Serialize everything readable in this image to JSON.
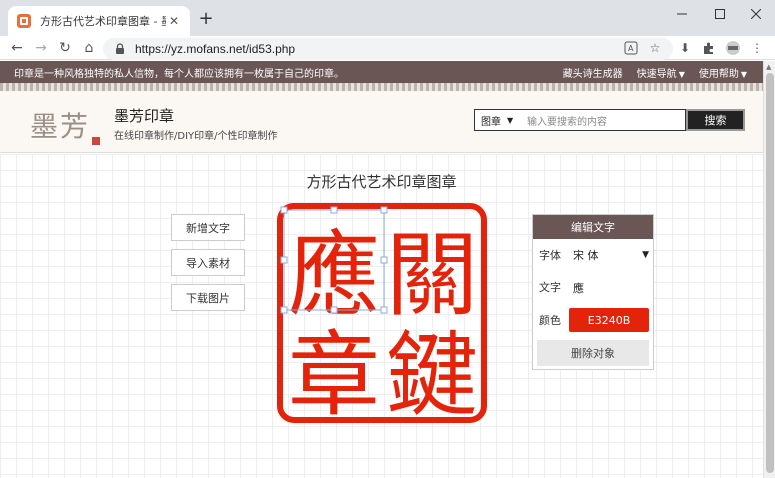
{
  "browser": {
    "tab_title": "方形古代艺术印章图章 - 墨芳印章",
    "url": "https://yz.mofans.net/id53.php"
  },
  "site": {
    "intro": "印章是一种风格独特的私人信物，每个人都应该拥有一枚属于自己的印章。",
    "nav": [
      "藏头诗生成器",
      "快速导航",
      "使用帮助"
    ],
    "logo_text": "墨芳",
    "brand": "墨芳印章",
    "tagline": "在线印章制作/DIY印章/个性印章制作",
    "search": {
      "category": "图章",
      "placeholder": "输入要搜索的内容",
      "button": "搜索"
    }
  },
  "editor": {
    "title": "方形古代艺术印章图章",
    "actions": [
      "新增文字",
      "导入素材",
      "下载图片"
    ],
    "seal_chars": [
      "應",
      "關",
      "章",
      "鍵"
    ],
    "seal_color": "#E3240B",
    "panel": {
      "title": "编辑文字",
      "font_label": "字体",
      "font_value": "宋 体",
      "text_label": "文字",
      "text_value": "應",
      "color_label": "颜色",
      "color_value": "E3240B",
      "delete_label": "删除对象"
    }
  },
  "colors": {
    "header_brown": "#6b5656",
    "seal_red": "#e3240b"
  }
}
